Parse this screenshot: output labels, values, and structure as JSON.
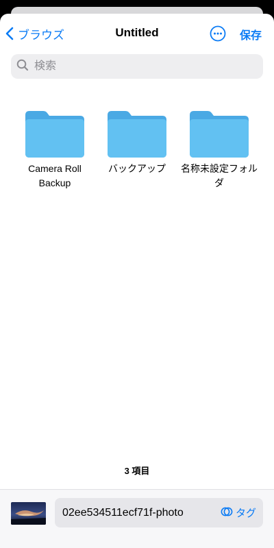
{
  "navbar": {
    "back_label": "ブラウズ",
    "title": "Untitled",
    "save_label": "保存"
  },
  "search": {
    "placeholder": "検索",
    "value": ""
  },
  "folders": [
    {
      "label": "Camera Roll Backup"
    },
    {
      "label": "バックアップ"
    },
    {
      "label": "名称未設定フォルダ"
    }
  ],
  "footer": {
    "item_count": "3 項目"
  },
  "save_bar": {
    "filename": "02ee534511ecf71f-photo",
    "tag_label": "タグ"
  },
  "colors": {
    "accent": "#0a7bf5",
    "folder": "#5ab8ee"
  }
}
